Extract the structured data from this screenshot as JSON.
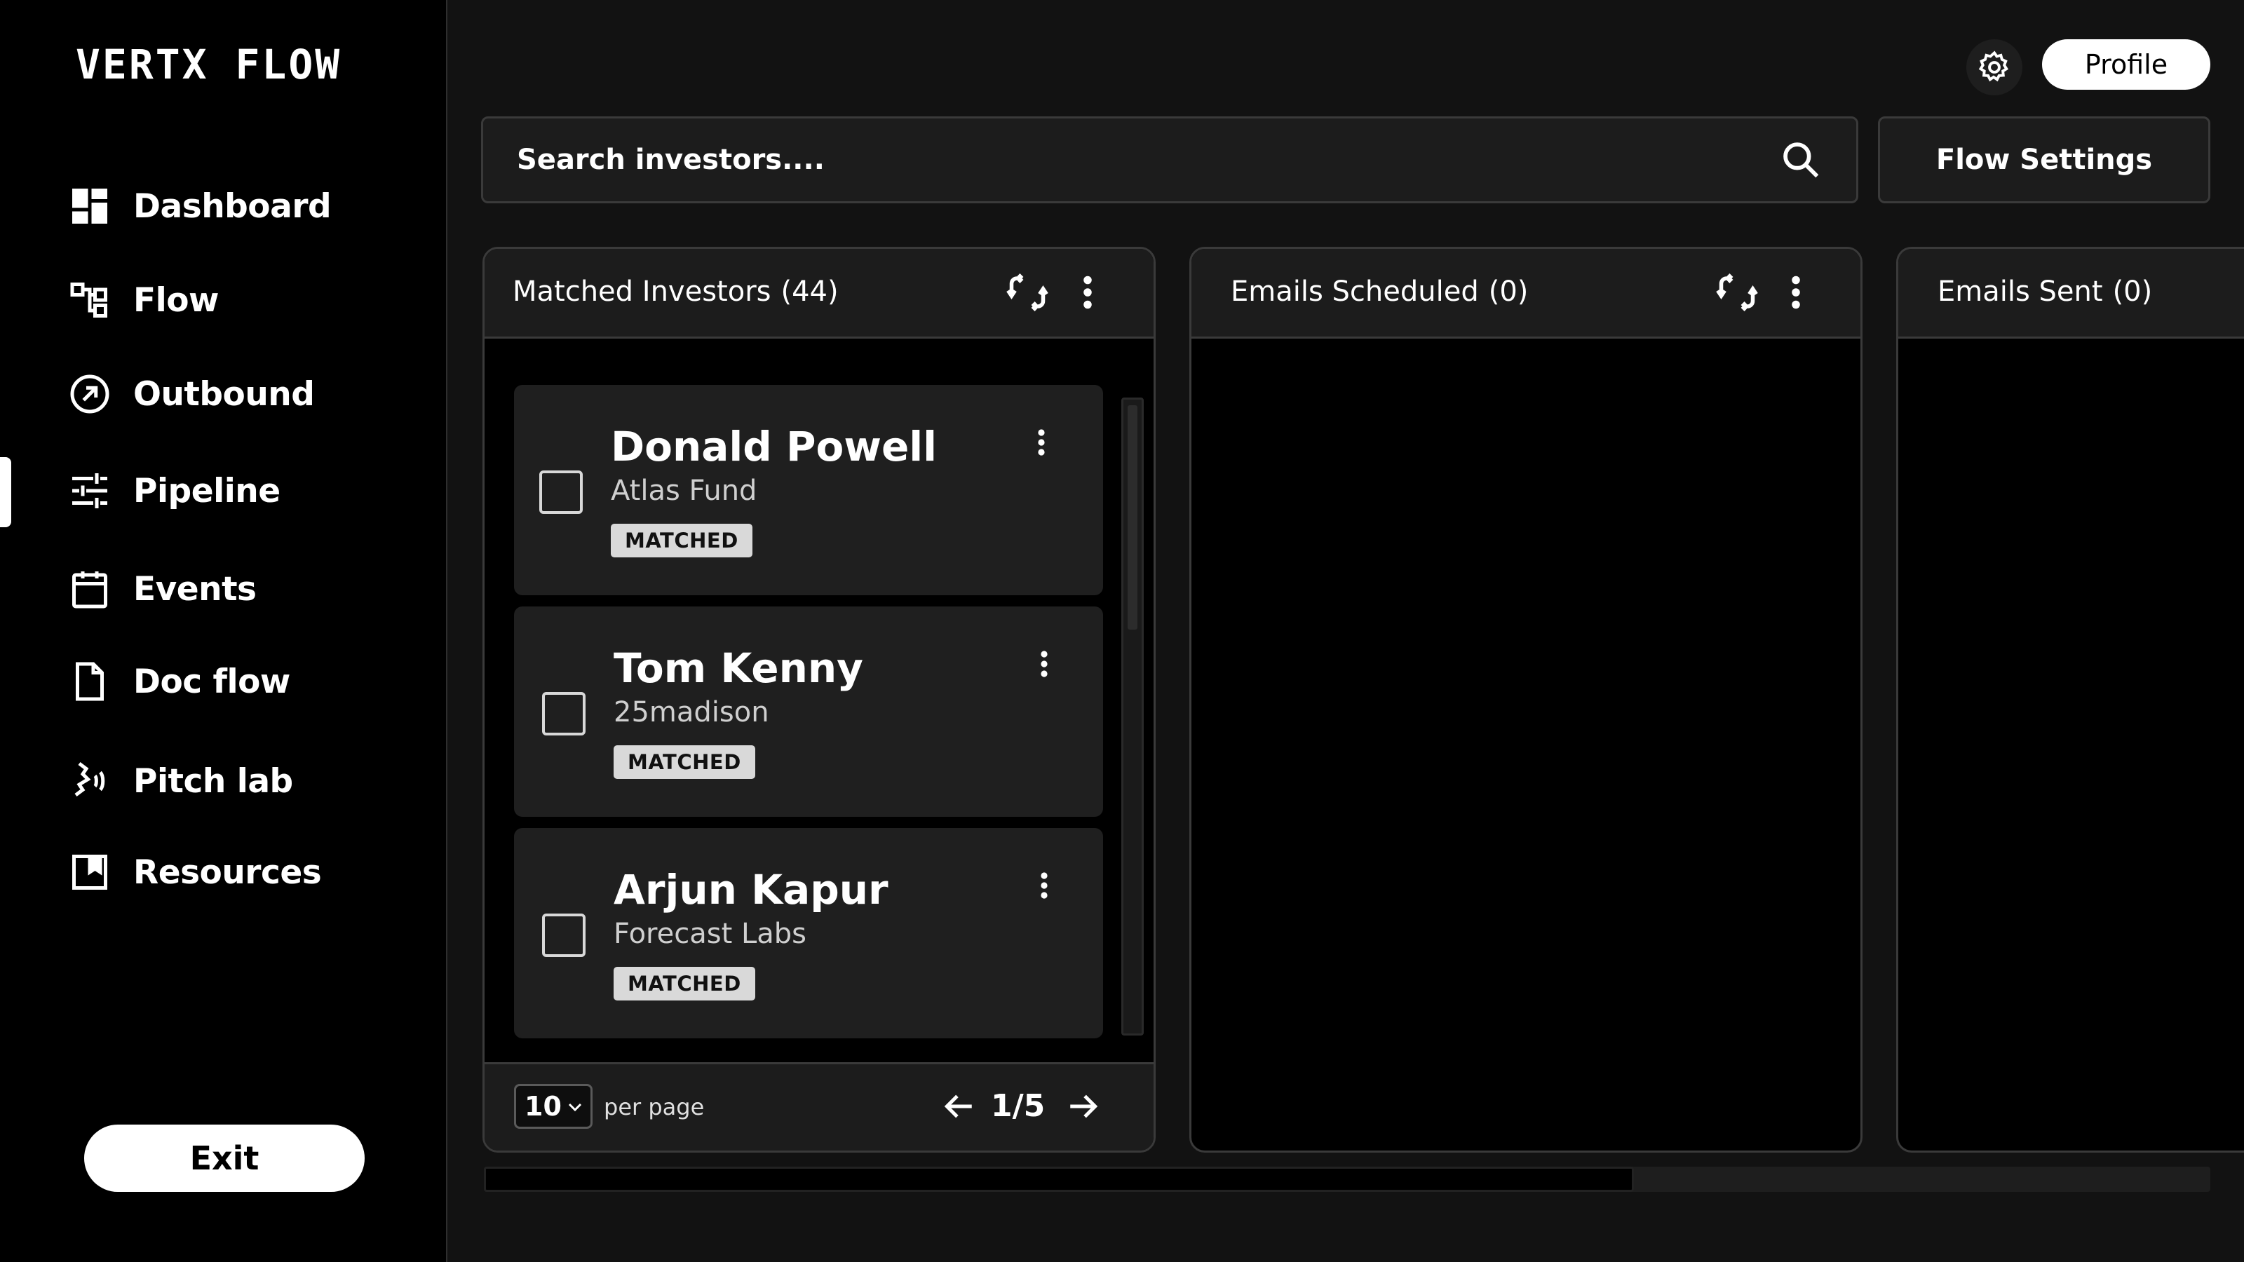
{
  "app": {
    "logo": "VERTX FLOW"
  },
  "sidebar": {
    "items": [
      {
        "label": "Dashboard",
        "icon": "dashboard-icon"
      },
      {
        "label": "Flow",
        "icon": "flow-icon"
      },
      {
        "label": "Outbound",
        "icon": "outbound-icon"
      },
      {
        "label": "Pipeline",
        "icon": "pipeline-icon",
        "active": true
      },
      {
        "label": "Events",
        "icon": "calendar-icon"
      },
      {
        "label": "Doc flow",
        "icon": "document-icon"
      },
      {
        "label": "Pitch lab",
        "icon": "pitch-voice-icon"
      },
      {
        "label": "Resources",
        "icon": "bookmark-icon"
      }
    ],
    "exit_label": "Exit"
  },
  "topbar": {
    "profile_label": "Profile"
  },
  "search": {
    "placeholder": "Search investors....",
    "value": ""
  },
  "flow_settings_label": "Flow Settings",
  "columns": [
    {
      "title": "Matched Investors",
      "count": "(44)",
      "cards": [
        {
          "name": "Donald Powell",
          "company": "Atlas Fund",
          "status": "MATCHED"
        },
        {
          "name": "Tom Kenny",
          "company": "25madison",
          "status": "MATCHED"
        },
        {
          "name": "Arjun Kapur",
          "company": "Forecast Labs",
          "status": "MATCHED"
        }
      ],
      "footer": {
        "per_page_value": "10",
        "per_page_label": "per page",
        "page_indicator": "1/5"
      }
    },
    {
      "title": "Emails Scheduled",
      "count": "(0)"
    },
    {
      "title": "Emails Sent",
      "count": "(0)"
    }
  ],
  "horizontal_scroll_position": 0.666,
  "colors": {
    "background": "#000000",
    "panel": "#1c1c1c",
    "card": "#1f1f1f",
    "badge": "#d9d9d9",
    "accent": "#ffffff"
  }
}
